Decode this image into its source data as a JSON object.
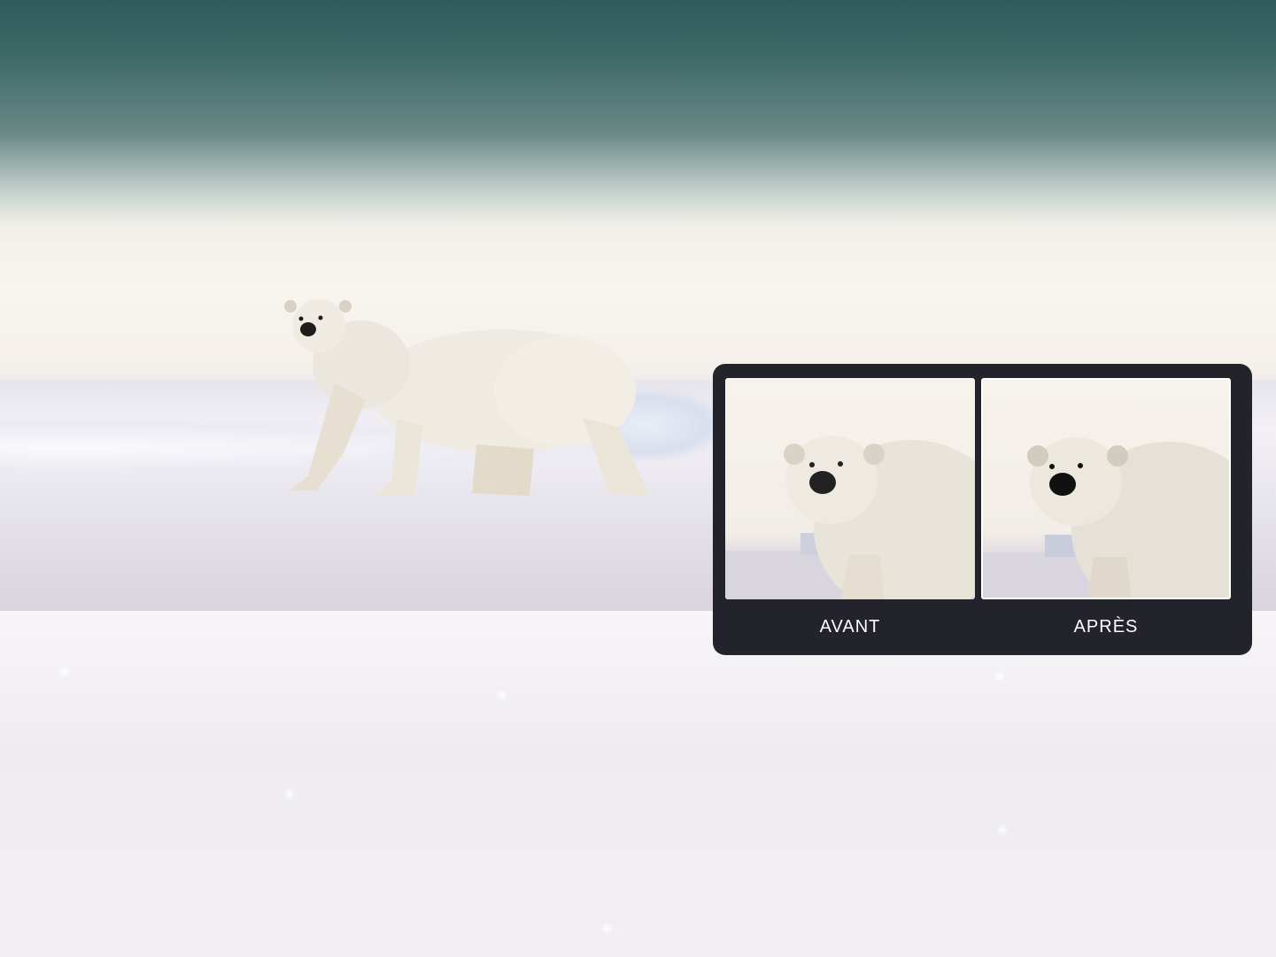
{
  "comparison": {
    "before_label": "AVANT",
    "after_label": "APRÈS"
  },
  "colors": {
    "panel_background": "#23232c",
    "sky_top": "#2e5c5a",
    "snow": "#f2eff4"
  }
}
